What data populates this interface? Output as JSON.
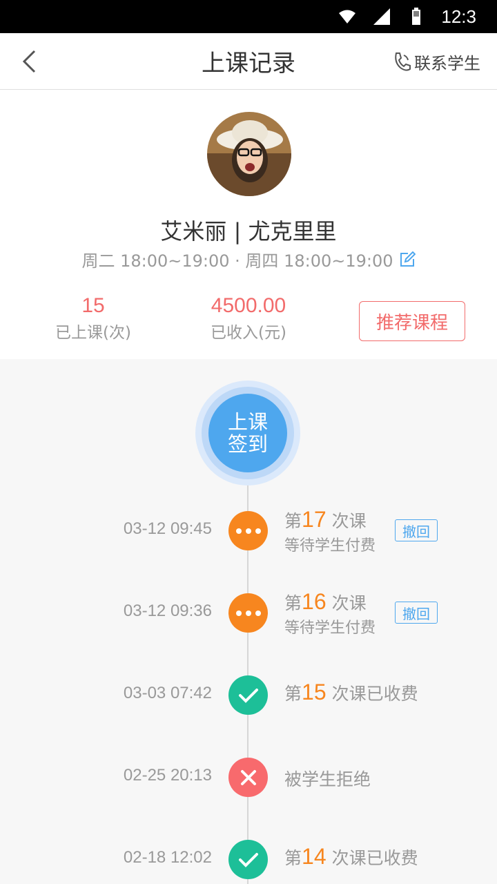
{
  "status_bar": {
    "time": "12:3",
    "icons": [
      "wifi-icon",
      "signal-icon",
      "battery-icon"
    ]
  },
  "nav": {
    "title": "上课记录",
    "contact_label": "联系学生",
    "icons": [
      "back-arrow-icon",
      "phone-icon"
    ]
  },
  "profile": {
    "name": "艾米丽 | 尤克里里",
    "schedule": "周二 18:00~19:00 · 周四 18:00~19:00",
    "edit_icon": "edit-icon",
    "stats": [
      {
        "value": "15",
        "label": "已上课(次)"
      },
      {
        "value": "4500.00",
        "label": "已收入(元)"
      }
    ],
    "recommend_label": "推荐课程"
  },
  "checkin": {
    "line1": "上课",
    "line2": "签到"
  },
  "records": [
    {
      "date": "03-12 09:45",
      "status": "pending",
      "prefix": "第",
      "num": "17",
      "suffix": "次课",
      "sub": "等待学生付费",
      "action": "撤回"
    },
    {
      "date": "03-12 09:36",
      "status": "pending",
      "prefix": "第",
      "num": "16",
      "suffix": "次课",
      "sub": "等待学生付费",
      "action": "撤回"
    },
    {
      "date": "03-03 07:42",
      "status": "paid",
      "prefix": "第",
      "num": "15",
      "suffix": "次课已收费"
    },
    {
      "date": "02-25 20:13",
      "status": "rejected",
      "text": "被学生拒绝"
    },
    {
      "date": "02-18 12:02",
      "status": "paid",
      "prefix": "第",
      "num": "14",
      "suffix": "次课已收费"
    }
  ],
  "colors": {
    "accent_red": "#f26b6b",
    "accent_blue": "#4ea7ee",
    "pending_orange": "#f7861f",
    "paid_green": "#1dbf98",
    "rejected_red": "#f86a6d"
  }
}
